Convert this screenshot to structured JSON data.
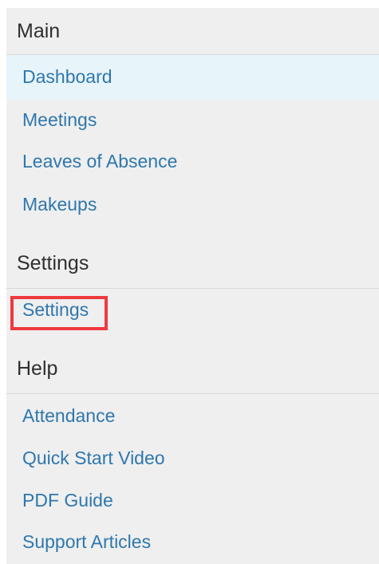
{
  "sections": [
    {
      "title": "Main",
      "items": [
        {
          "label": "Dashboard",
          "active": true
        },
        {
          "label": "Meetings",
          "active": false
        },
        {
          "label": "Leaves of Absence",
          "active": false
        },
        {
          "label": "Makeups",
          "active": false
        }
      ]
    },
    {
      "title": "Settings",
      "items": [
        {
          "label": "Settings",
          "active": false,
          "highlighted": true
        }
      ]
    },
    {
      "title": "Help",
      "items": [
        {
          "label": "Attendance",
          "active": false
        },
        {
          "label": "Quick Start Video",
          "active": false
        },
        {
          "label": "PDF Guide",
          "active": false
        },
        {
          "label": "Support Articles",
          "active": false
        }
      ]
    }
  ],
  "colors": {
    "link": "#2f77ad",
    "active_background": "#e7f5fb",
    "panel_background": "#efefef",
    "highlight_border": "#ee3a3f",
    "header_text": "#2f2f2f"
  }
}
